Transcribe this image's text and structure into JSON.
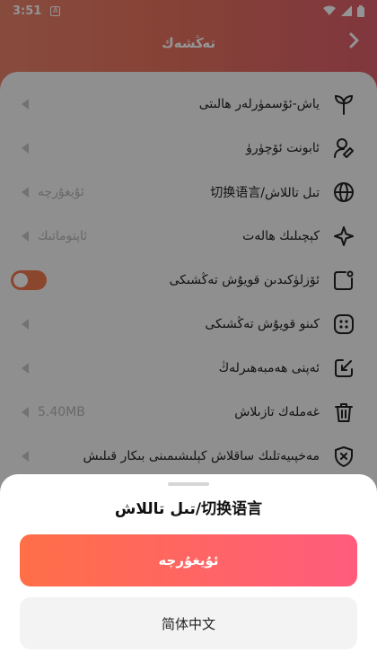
{
  "status_bar": {
    "time": "3:51",
    "notification": "A"
  },
  "header": {
    "title": "تەڭشەك",
    "back_icon": "chevron-right-icon"
  },
  "settings": [
    {
      "id": "teen-mode",
      "label": "ياش-ئۆسمۈرلەر ھالىتى",
      "icon": "sprout-icon",
      "value": "",
      "control": "arrow"
    },
    {
      "id": "account",
      "label": "ئابونت ئۆچۈرۈ",
      "icon": "user-edit-icon",
      "value": "",
      "control": "arrow"
    },
    {
      "id": "language",
      "label": "تىل تاللاش/切换语言",
      "icon": "globe-icon",
      "value": "ئۇيغۇرچە",
      "control": "arrow"
    },
    {
      "id": "skin-mode",
      "label": "كېچىلىك ھالەت",
      "icon": "sparkle-icon",
      "value": "ئاپتوماتىك",
      "control": "arrow"
    },
    {
      "id": "autoplay",
      "label": "ئۆزلۈكىدىن قويۇش تەڭشىكى",
      "icon": "autoplay-icon",
      "value": "",
      "control": "toggle"
    },
    {
      "id": "player",
      "label": "كىنو قويۇش تەڭشىكى",
      "icon": "film-reel-icon",
      "value": "",
      "control": "arrow"
    },
    {
      "id": "rate",
      "label": "ئەپنى ھەمبەھىرلەڭ",
      "icon": "edit-square-icon",
      "value": "",
      "control": "arrow"
    },
    {
      "id": "cache",
      "label": "غەملەك تازىلاش",
      "icon": "trash-icon",
      "value": "5.40MB",
      "control": "arrow"
    },
    {
      "id": "privacy",
      "label": "مەخپىيەتلىك ساقلاش كېلىشىمىنى بىكار قىلىش",
      "icon": "shield-x-icon",
      "value": "",
      "control": "arrow"
    }
  ],
  "sheet": {
    "title": "تىل تاللاش/切换语言",
    "options": [
      {
        "label": "ئۇيغۇرچە",
        "selected": true
      },
      {
        "label": "简体中文",
        "selected": false
      }
    ]
  },
  "colors": {
    "accent": "#ff6f47",
    "accent_end": "#ff5c7e",
    "header": "#e8745e"
  }
}
